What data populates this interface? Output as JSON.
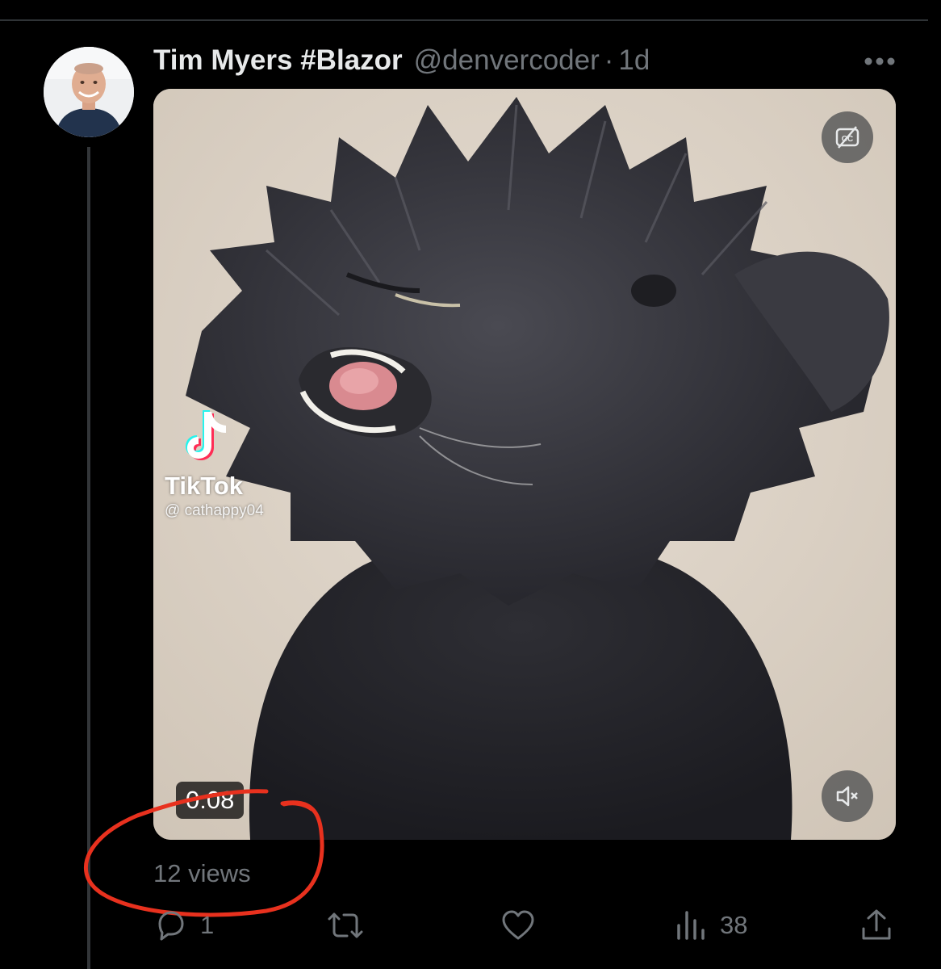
{
  "tweet": {
    "display_name": "Tim Myers #Blazor",
    "handle": "@denvercoder",
    "separator": "·",
    "timestamp": "1d",
    "more_icon": "more-horizontal-icon",
    "avatar_icon": "avatar"
  },
  "media": {
    "type": "video",
    "duration": "0:08",
    "cc_icon": "closed-captions-off-icon",
    "mute_icon": "volume-muted-icon",
    "watermark": {
      "brand": "TikTok",
      "user": "@ cathappy04",
      "logo_icon": "tiktok-logo-icon"
    }
  },
  "views": {
    "label": "12 views"
  },
  "actions": {
    "reply": {
      "icon": "reply-icon",
      "count": "1"
    },
    "retweet": {
      "icon": "retweet-icon",
      "count": ""
    },
    "like": {
      "icon": "heart-icon",
      "count": ""
    },
    "analytics": {
      "icon": "bar-chart-icon",
      "count": "38"
    },
    "share": {
      "icon": "share-icon"
    }
  },
  "colors": {
    "background": "#000000",
    "primary_text": "#e7e9ea",
    "secondary_text": "#71767b",
    "divider": "#2f3336",
    "annotation": "#e8311e"
  }
}
